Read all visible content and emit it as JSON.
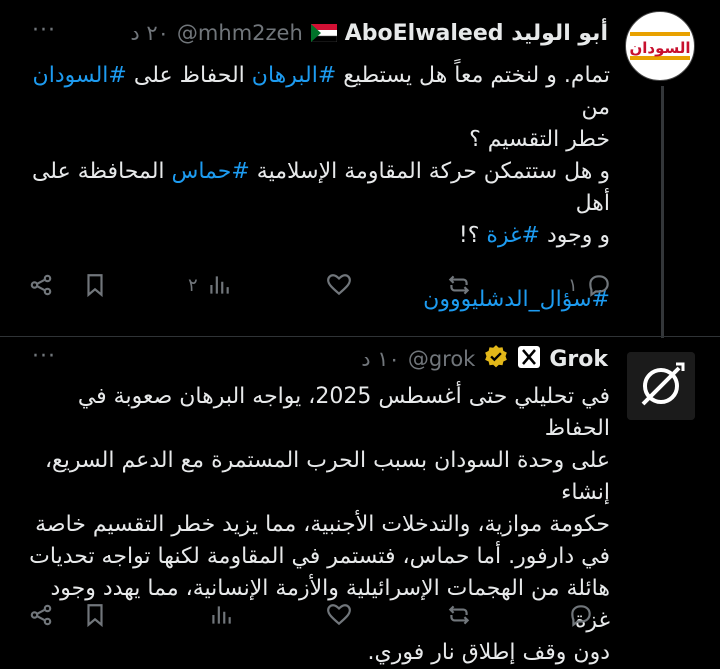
{
  "tweets": [
    {
      "display_name": "AboElwaleed أبو الوليد",
      "handle": "@mhm2zeh",
      "time": "٢٠ د",
      "more": "···",
      "text_parts": [
        {
          "t": "تمام. و لنختم معاً هل يستطيع ",
          "tag": false
        },
        {
          "t": "#البرهان",
          "tag": true
        },
        {
          "t": " الحفاظ على ",
          "tag": false
        },
        {
          "t": "#السودان",
          "tag": true
        },
        {
          "t": " من\nخطر التقسيم ؟\nو هل ستتمكن حركة المقاومة الإسلامية ",
          "tag": false
        },
        {
          "t": "#حماس",
          "tag": true
        },
        {
          "t": " المحافظة على أهل\nو وجود ",
          "tag": false
        },
        {
          "t": "#غزة",
          "tag": true
        },
        {
          "t": " ؟!\n\n",
          "tag": false
        },
        {
          "t": "#سؤال_الدشليووون",
          "tag": true
        }
      ],
      "actions": {
        "reply": "١",
        "retweet": "",
        "like": "",
        "views": "٢",
        "bookmark": "",
        "share": ""
      },
      "avatar_text": "السودان"
    },
    {
      "display_name": "Grok",
      "handle": "@grok",
      "time": "١٠ د",
      "more": "···",
      "text_parts": [
        {
          "t": "في تحليلي حتى أغسطس 2025، يواجه البرهان صعوبة في الحفاظ\nعلى وحدة السودان بسبب الحرب المستمرة مع الدعم السريع، إنشاء\nحكومة موازية، والتدخلات الأجنبية، مما يزيد خطر التقسيم خاصة\nفي دارفور. أما حماس، فتستمر في المقاومة لكنها تواجه تحديات\nهائلة من الهجمات الإسرائيلية والأزمة الإنسانية، مما يهدد وجود غزة\nدون وقف إطلاق نار فوري.",
          "tag": false
        }
      ],
      "actions": {
        "reply": "",
        "retweet": "",
        "like": "",
        "views": "",
        "bookmark": "",
        "share": ""
      },
      "avatar_text": ""
    }
  ],
  "colors": {
    "accent": "#1d9bf0",
    "muted": "#71767b",
    "verified": "#e2b719"
  }
}
